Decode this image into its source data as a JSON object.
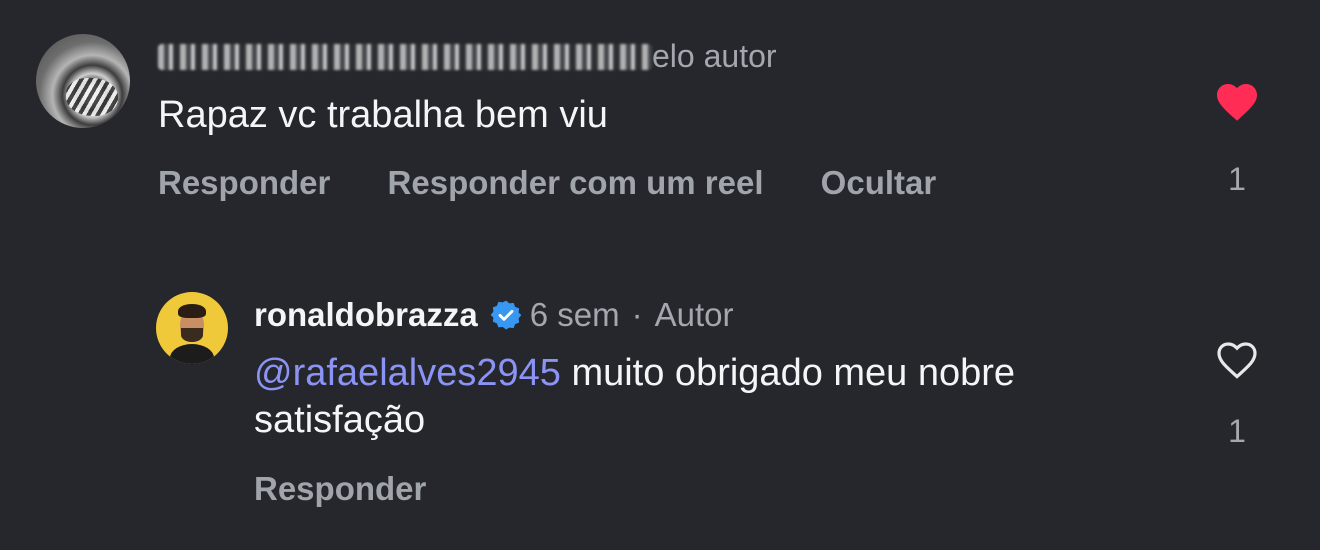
{
  "comment": {
    "author_suffix": "elo autor",
    "text": "Rapaz vc trabalha bem viu",
    "actions": {
      "reply": "Responder",
      "reply_reel": "Responder com um reel",
      "hide": "Ocultar"
    },
    "liked": true,
    "like_count": "1"
  },
  "reply": {
    "username": "ronaldobrazza",
    "time": "6 sem",
    "separator": "·",
    "role": "Autor",
    "mention": "@rafaelalves2945",
    "text": "muito obrigado meu nobre satisfação",
    "actions": {
      "reply": "Responder"
    },
    "liked": false,
    "like_count": "1"
  },
  "colors": {
    "background": "#25272c",
    "like_red": "#ff2d55",
    "mention": "#8b93f5",
    "verified": "#3897f0"
  },
  "icons": {
    "like_filled": "heart-filled-icon",
    "like_outline": "heart-outline-icon",
    "verified": "verified-badge-icon"
  }
}
